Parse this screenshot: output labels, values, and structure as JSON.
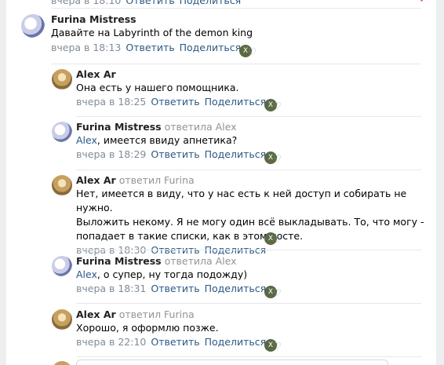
{
  "top": {
    "time": "вчера в 18:10",
    "reply": "Ответить",
    "share": "Поделиться"
  },
  "comments": [
    {
      "author": "Furina Mistress",
      "reply_to": "",
      "text": "Давайте на Labyrinth of the demon king",
      "time": "вчера в 18:13",
      "reply": "Ответить",
      "share": "Поделиться"
    },
    {
      "author": "Alex Ar",
      "reply_to": "",
      "text": "Она есть у нашего помощника.",
      "time": "вчера в 18:25",
      "reply": "Ответить",
      "share": "Поделиться"
    },
    {
      "author": "Furina Mistress",
      "reply_to": "ответила Alex",
      "mention": "Alex",
      "text": ", имеется ввиду апнетика?",
      "time": "вчера в 18:29",
      "reply": "Ответить",
      "share": "Поделиться"
    },
    {
      "author": "Alex Ar",
      "reply_to": "ответил Furina",
      "text_lines": [
        "Нет, имеется в виду, что у нас есть к ней доступ и собирать не нужно.",
        "Выложить некому. Я не могу один всё выкладывать. То, что могу -",
        "попадает в такие списки, как в этом посте."
      ],
      "time": "вчера в 18:30",
      "reply": "Ответить",
      "share": "Поделиться"
    },
    {
      "author": "Furina Mistress",
      "reply_to": "ответила Alex",
      "mention": "Alex",
      "text": ", о супер, ну тогда подожду)",
      "time": "вчера в 18:31",
      "reply": "Ответить",
      "share": "Поделиться"
    },
    {
      "author": "Alex Ar",
      "reply_to": "ответил Furina",
      "text": "Хорошо, я оформлю позже.",
      "time": "вчера в 22:10",
      "reply": "Ответить",
      "share": "Поделиться"
    }
  ],
  "colors": {
    "link": "#2a5885",
    "meta": "#818c99",
    "separator": "#e7e8ec",
    "background": "#edeef0"
  },
  "icons": {
    "like": "heart-icon",
    "liker": "liker-avatar-icon"
  }
}
